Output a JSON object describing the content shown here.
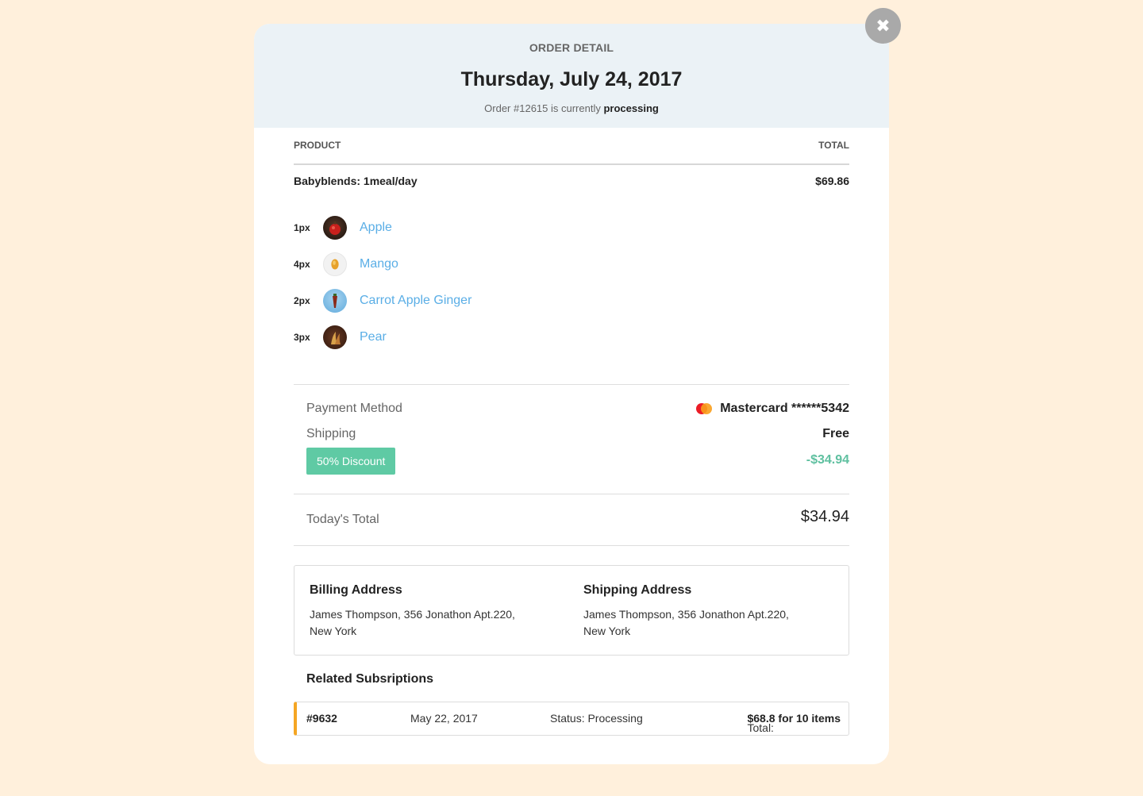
{
  "header": {
    "label": "ORDER DETAIL",
    "date": "Thursday, July 24, 2017",
    "status_prefix": "Order #12615 is currently",
    "status": "processing"
  },
  "table": {
    "col_product": "PRODUCT",
    "col_total": "TOTAL",
    "plan_name": "Babyblends: 1meal/day",
    "plan_total": "$69.86"
  },
  "items": [
    {
      "qty": "1px",
      "name": "Apple",
      "icon": "apple-thumbnail"
    },
    {
      "qty": "4px",
      "name": "Mango",
      "icon": "mango-thumbnail"
    },
    {
      "qty": "2px",
      "name": "Carrot Apple Ginger",
      "icon": "carrot-thumbnail"
    },
    {
      "qty": "3px",
      "name": "Pear",
      "icon": "pear-thumbnail"
    }
  ],
  "payment": {
    "method_label": "Payment Method",
    "method_value": "Mastercard ******5342",
    "shipping_label": "Shipping",
    "shipping_value": "Free",
    "discount_label": "50% Discount",
    "discount_value": "-$34.94",
    "total_label": "Today's Total",
    "total_value": "$34.94"
  },
  "billing": {
    "title": "Billing Address",
    "line1": "James Thompson, 356 Jonathon Apt.220,",
    "line2": "New York"
  },
  "shipping": {
    "title": "Shipping Address",
    "line1": "James Thompson, 356 Jonathon Apt.220,",
    "line2": "New York"
  },
  "related": {
    "title": "Related Subsriptions",
    "id": "#9632",
    "date": "May 22, 2017",
    "status": "Status: Processing",
    "total_prefix": "Total:",
    "total_value": "$68.8 for 10 items"
  },
  "colors": {
    "background": "#fff0dc",
    "link": "#5aaee6",
    "discount": "#5fcaa4",
    "accent_bar": "#f5a623"
  }
}
